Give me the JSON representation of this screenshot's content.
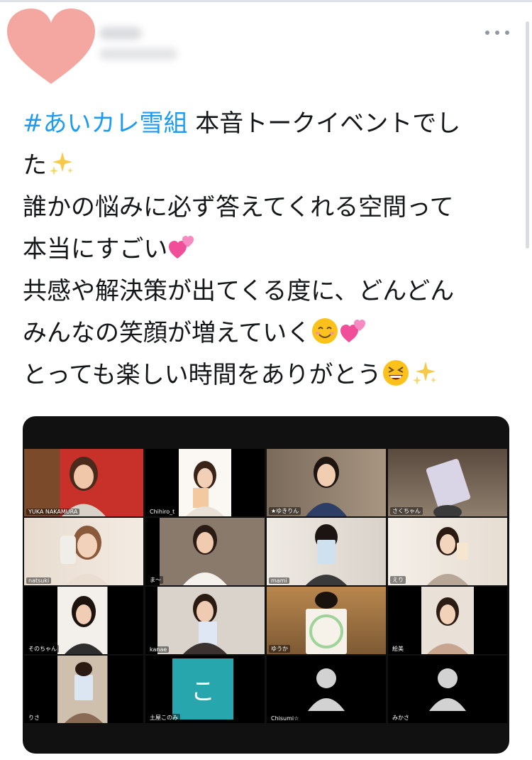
{
  "tweet": {
    "hashtag": "#あいカレ雪組",
    "lines": [
      " 本音トークイベントでし",
      "た",
      "誰かの悩みに必ず答えてくれる空間って",
      "本当にすごい",
      "共感や解決策が出てくる度に、どんどん",
      "みんなの笑顔が増えていく",
      "とっても楽しい時間をありがとう"
    ],
    "emojis": [
      "sparkles-emoji",
      "two-hearts-emoji",
      "smiling-face-emoji",
      "two-hearts-emoji",
      "grinning-squinting-face-emoji",
      "sparkles-emoji"
    ]
  },
  "colors": {
    "hashtag": "#1d9bf0",
    "text": "#14171a",
    "avatar_heart": "#f4a7a1",
    "active_speaker": "#7fd33a",
    "tile_teal": "#27a6ad"
  },
  "video_call": {
    "participants": [
      "YUKA NAKAMURA",
      "Chihiro_t",
      "★ゆきりん",
      "さくちゃん",
      "natsuki",
      "ま～",
      "mami",
      "えり",
      "そのちゃん",
      "kanae",
      "ゆうか",
      "絵美",
      "りさ",
      "土屋このみ",
      "Chisumi☆",
      "みかさ"
    ],
    "letter_tile": "こ"
  }
}
